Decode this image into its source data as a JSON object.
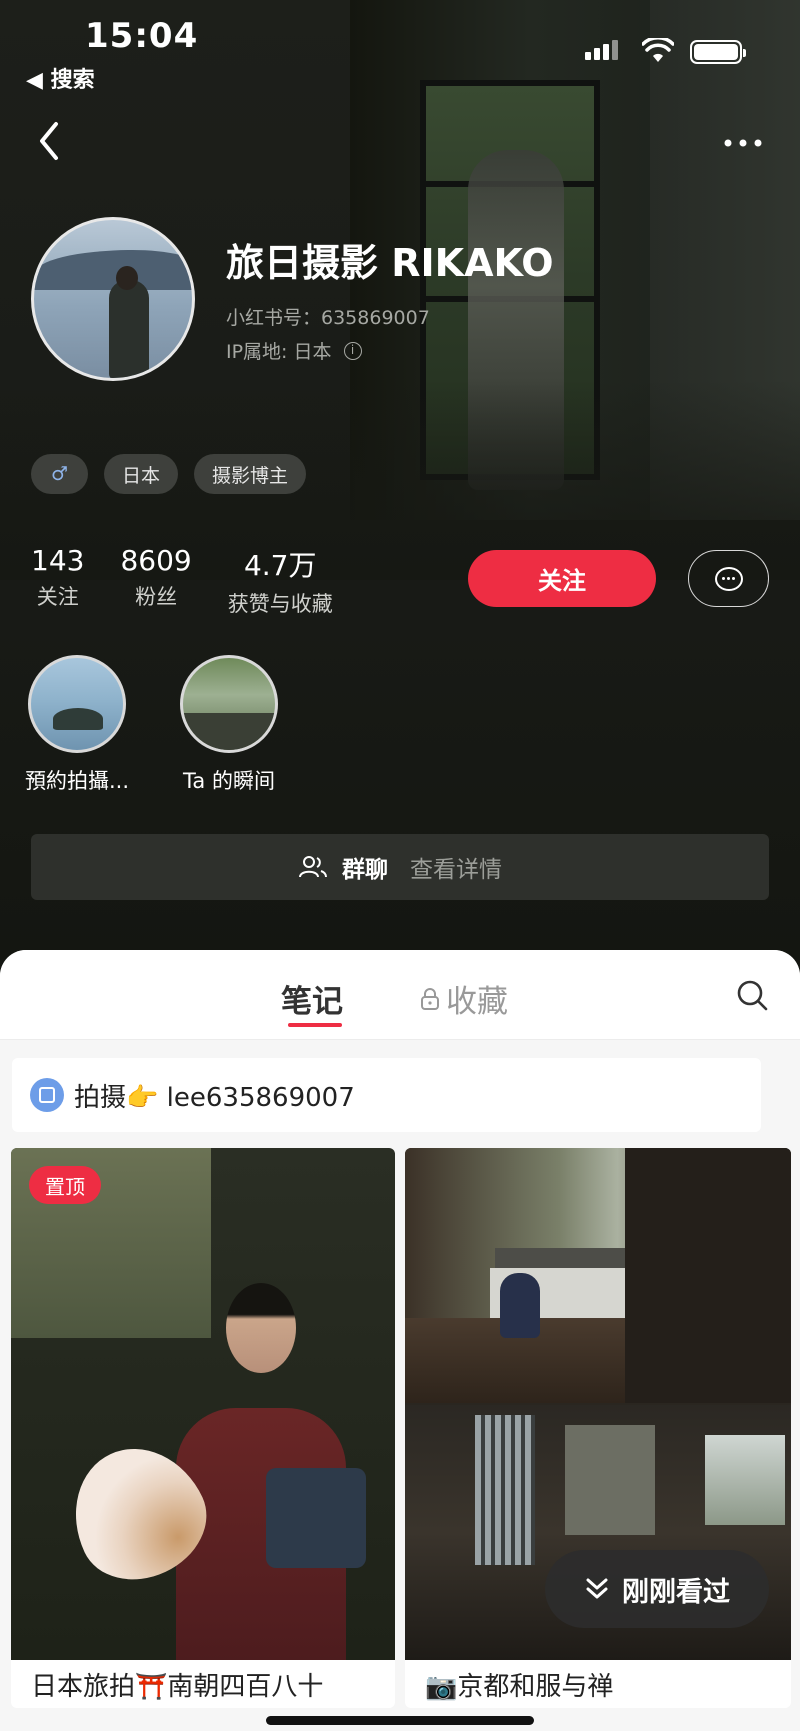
{
  "status_bar": {
    "time": "15:04",
    "back_app": "◀ 搜索"
  },
  "profile": {
    "name": "旅日摄影 RIKAKO",
    "redbook_id": "小红书号：635869007",
    "ip_location": "IP属地: 日本",
    "tags": [
      "♂",
      "日本",
      "摄影博主"
    ],
    "stats": [
      {
        "value": "143",
        "label": "关注"
      },
      {
        "value": "8609",
        "label": "粉丝"
      },
      {
        "value": "4.7万",
        "label": "获赞与收藏"
      }
    ],
    "follow_label": "关注",
    "highlights": [
      {
        "label": "預約拍攝..."
      },
      {
        "label": "Ta 的瞬间"
      }
    ],
    "group": {
      "label": "群聊",
      "detail": "查看详情"
    }
  },
  "tabs": {
    "notes": "笔记",
    "favorites": "收藏"
  },
  "bio_link": "拍摄👉 lee635869007",
  "cards": [
    {
      "pin_label": "置顶",
      "title": "日本旅拍⛩️南朝四百八十"
    },
    {
      "title": "📷京都和服与禅"
    }
  ],
  "recently_viewed": "刚刚看过",
  "colors": {
    "accent": "#ee2d43",
    "bg_dark": "#161813"
  }
}
